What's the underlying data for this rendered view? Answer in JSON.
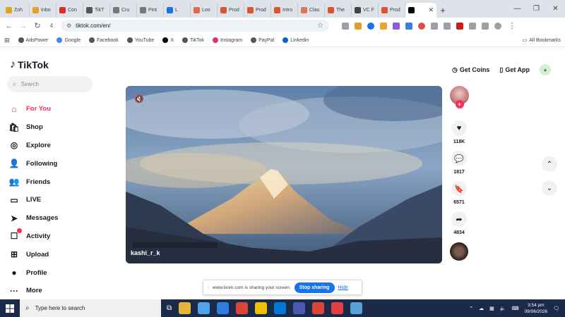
{
  "browser": {
    "tabs": [
      {
        "label": "Zoh",
        "color": "#e4a12a"
      },
      {
        "label": "Inbo",
        "color": "#e4a12a"
      },
      {
        "label": "Con",
        "color": "#d93025"
      },
      {
        "label": "TikT",
        "color": "#555555"
      },
      {
        "label": "Cru",
        "color": "#777777"
      },
      {
        "label": "Pint",
        "color": "#777777"
      },
      {
        "label": "L",
        "color": "#1a73e8"
      },
      {
        "label": "Loo",
        "color": "#e06b4a"
      },
      {
        "label": "Prod",
        "color": "#da552f"
      },
      {
        "label": "Prod",
        "color": "#da552f"
      },
      {
        "label": "Intro",
        "color": "#da552f"
      },
      {
        "label": "Clau",
        "color": "#d97757"
      },
      {
        "label": "The",
        "color": "#da552f"
      },
      {
        "label": "VC F",
        "color": "#444444"
      },
      {
        "label": "Prod",
        "color": "#da552f"
      }
    ],
    "active_tab_close": "✕",
    "new_tab": "+",
    "window_controls": [
      "—",
      "❐",
      "✕"
    ],
    "url": "tiktok.com/en/",
    "reload_count": "4"
  },
  "bookmarks": [
    {
      "label": "AdsPower",
      "color": "#555555"
    },
    {
      "label": "Google",
      "color": "#4285f4"
    },
    {
      "label": "Facebook",
      "color": "#555555"
    },
    {
      "label": "YouTube",
      "color": "#555555"
    },
    {
      "label": "X",
      "color": "#000000"
    },
    {
      "label": "TikTok",
      "color": "#555555"
    },
    {
      "label": "Instagram",
      "color": "#e1306c"
    },
    {
      "label": "PayPal",
      "color": "#555555"
    },
    {
      "label": "Linkedin",
      "color": "#0a66c2"
    }
  ],
  "bookmarks_all": "All Bookmarks",
  "tiktok": {
    "logo": "TikTok",
    "search_placeholder": "Search",
    "nav": [
      {
        "label": "For You",
        "icon": "home-icon",
        "glyph": "⌂"
      },
      {
        "label": "Shop",
        "icon": "shopping-bag-icon",
        "glyph": "🛍"
      },
      {
        "label": "Explore",
        "icon": "compass-icon",
        "glyph": "◎"
      },
      {
        "label": "Following",
        "icon": "person-plus-icon",
        "glyph": "👤"
      },
      {
        "label": "Friends",
        "icon": "people-icon",
        "glyph": "👥"
      },
      {
        "label": "LIVE",
        "icon": "live-icon",
        "glyph": "▭"
      },
      {
        "label": "Messages",
        "icon": "paper-plane-icon",
        "glyph": "➤"
      },
      {
        "label": "Activity",
        "icon": "activity-icon",
        "glyph": "☐"
      },
      {
        "label": "Upload",
        "icon": "upload-icon",
        "glyph": "⊞"
      },
      {
        "label": "Profile",
        "icon": "profile-icon",
        "glyph": "●"
      },
      {
        "label": "More",
        "icon": "more-icon",
        "glyph": "···"
      }
    ],
    "get_coins": "Get Coins",
    "get_app": "Get App",
    "video_author": "kashi_r_k",
    "likes": "118K",
    "comments": "1817",
    "saves": "6571",
    "shares": "4834"
  },
  "loom_bar": {
    "message": "www.loom.com is sharing your screen.",
    "stop": "Stop sharing",
    "hide": "Hide"
  },
  "taskbar": {
    "search_placeholder": "Type here to search",
    "time": "3:54 pm",
    "date": "09/06/2026",
    "apps": [
      "#e8b33a",
      "#4fa3e8",
      "#2f7de1",
      "#db4437",
      "#f0c000",
      "#0078d4",
      "#4a5ab0",
      "#db4437",
      "#e04040",
      "#5aa0d8"
    ]
  }
}
